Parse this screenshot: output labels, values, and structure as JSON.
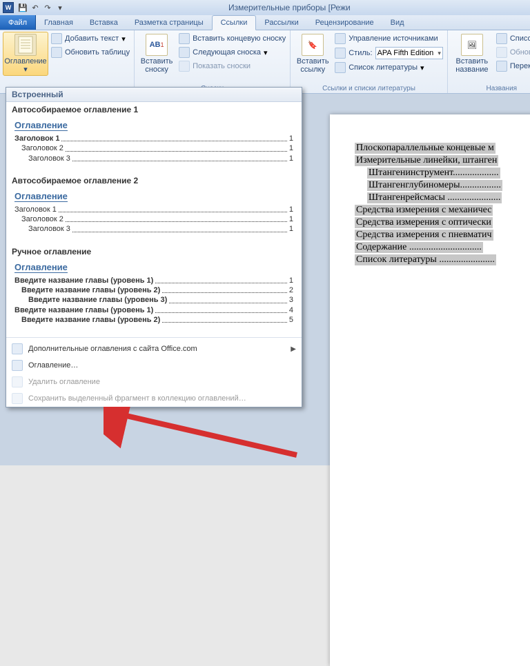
{
  "title": "Измерительные приборы [Режи",
  "tabs": {
    "file": "Файл",
    "home": "Главная",
    "insert": "Вставка",
    "layout": "Разметка страницы",
    "refs": "Ссылки",
    "mail": "Рассылки",
    "review": "Рецензирование",
    "view": "Вид"
  },
  "ribbon": {
    "toc_btn": "Оглавление",
    "add_text": "Добавить текст",
    "update_table": "Обновить таблицу",
    "insert_footnote": "Вставить сноску",
    "ab_label": "AB",
    "insert_endnote": "Вставить концевую сноску",
    "next_footnote": "Следующая сноска",
    "show_footnotes": "Показать сноски",
    "footnotes_group": "Сноски",
    "insert_link": "Вставить ссылку",
    "manage_sources": "Управление источниками",
    "style_label": "Стиль:",
    "style_value": "APA Fifth Edition",
    "bibliography": "Список литературы",
    "links_group": "Ссылки и списки литературы",
    "insert_caption": "Вставить название",
    "illus_list": "Список илл",
    "update_il": "Обновить т",
    "crossref": "Перекрестн",
    "captions_group": "Названия"
  },
  "dd": {
    "header": "Встроенный",
    "auto1": "Автособираемое оглавление 1",
    "auto2": "Автособираемое оглавление 2",
    "manual": "Ручное оглавление",
    "toc_title": "Оглавление",
    "h1": "Заголовок 1",
    "h2": "Заголовок 2",
    "h3": "Заголовок 3",
    "m1": "Введите название главы (уровень 1)",
    "m2": "Введите название главы (уровень 2)",
    "m3": "Введите название главы (уровень 3)",
    "p1": "1",
    "p2": "2",
    "p3": "3",
    "p4": "4",
    "p5": "5",
    "more": "Дополнительные оглавления с сайта Office.com",
    "custom": "Оглавление…",
    "remove": "Удалить оглавление",
    "save_sel": "Сохранить выделенный фрагмент в коллекцию оглавлений…"
  },
  "doc": {
    "l1": "Плоскопараллельные концевые м",
    "l2": "Измерительные линейки, штанген",
    "l3": "Штангенинструмент...................",
    "l4": "Штангенглубиномеры.................",
    "l5": "Штангенрейсмасы ......................",
    "l6": "Средства измерения с механичес",
    "l7": "Средства измерения с оптически",
    "l8": "Средства измерения с пневматич",
    "l9": "Содержание ..............................",
    "l10": "Список литературы ......................."
  }
}
